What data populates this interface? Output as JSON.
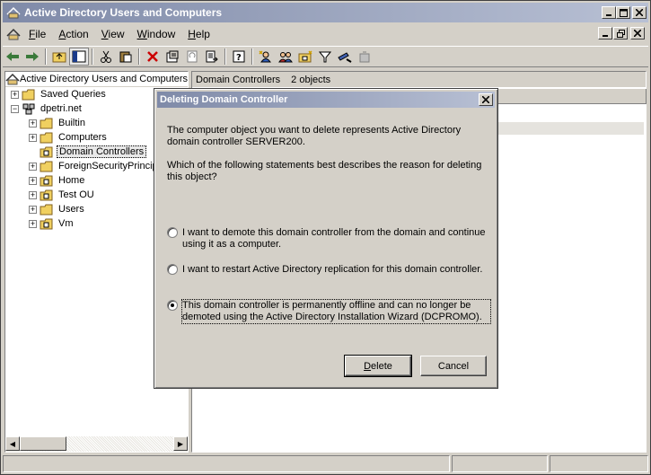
{
  "app": {
    "title": "Active Directory Users and Computers"
  },
  "menu": {
    "items": [
      {
        "accel": "F",
        "rest": "ile"
      },
      {
        "accel": "A",
        "rest": "ction"
      },
      {
        "accel": "V",
        "rest": "iew"
      },
      {
        "accel": "W",
        "rest": "indow"
      },
      {
        "accel": "H",
        "rest": "elp"
      }
    ]
  },
  "tree": {
    "root_label": "Active Directory Users and Computers",
    "items": [
      {
        "label": "Saved Queries"
      },
      {
        "label": "dpetri.net"
      },
      {
        "label": "Builtin"
      },
      {
        "label": "Computers"
      },
      {
        "label": "Domain Controllers"
      },
      {
        "label": "ForeignSecurityPrincip"
      },
      {
        "label": "Home"
      },
      {
        "label": "Test OU"
      },
      {
        "label": "Users"
      },
      {
        "label": "Vm"
      }
    ]
  },
  "right_pane": {
    "title": "Domain Controllers",
    "count": "2 objects",
    "column_fragment": "n"
  },
  "dialog": {
    "title": "Deleting Domain Controller",
    "intro": "The computer object you want to delete represents Active Directory domain controller SERVER200.",
    "question": "Which of the following statements best describes the reason for deleting this object?",
    "options": [
      {
        "label": "I want to demote this domain controller from the domain and continue using it as a computer.",
        "selected": false
      },
      {
        "label": "I want to restart Active Directory replication for this domain controller.",
        "selected": false
      },
      {
        "label": "This domain controller is permanently offline and can no longer be demoted using the Active Directory Installation Wizard (DCPROMO).",
        "selected": true
      }
    ],
    "delete_accel": "D",
    "delete_rest": "elete",
    "cancel_label": "Cancel"
  },
  "colors": {
    "title_start": "#7f8aa8",
    "title_end": "#b8c0d4",
    "face": "#d4d0c8",
    "delete_icon": "#cc0000"
  }
}
